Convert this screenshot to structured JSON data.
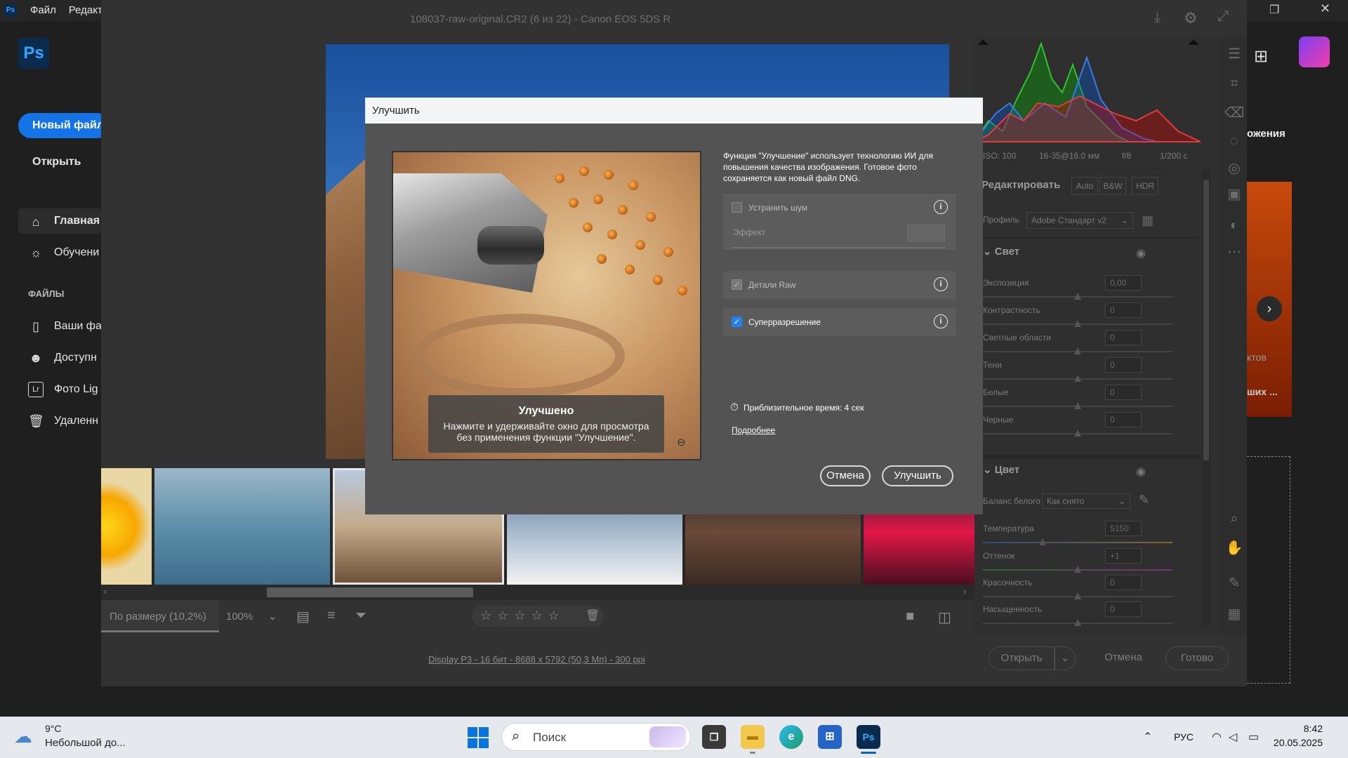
{
  "ps_home": {
    "menu": [
      "Файл",
      "Редакти"
    ],
    "logo": "Ps",
    "new_file_button": "Новый файл",
    "open_link": "Открыть",
    "nav": [
      {
        "icon": "home-icon",
        "label": "Главная"
      },
      {
        "icon": "lightbulb-icon",
        "label": "Обучени"
      }
    ],
    "files_heading": "ФАЙЛЫ",
    "files": [
      {
        "icon": "file-icon",
        "label": "Ваши фа"
      },
      {
        "icon": "people-icon",
        "label": "Доступн"
      },
      {
        "icon": "lightroom-icon",
        "label": "Фото Lig"
      },
      {
        "icon": "trash-icon",
        "label": "Удаленн"
      }
    ],
    "right_partial_1": "ожения",
    "right_partial_2": "ктов",
    "right_partial_3": "ших ..."
  },
  "acr": {
    "title": "108037-raw-original.CR2 (6 из 22)  -  Canon EOS 5DS R",
    "zoom_fit_label": "По размеру (10,2%)",
    "zoom_value": "100%",
    "status_link": "Display P3 - 16 бит - 8688 x 5792 (50,3 Мп) - 300 ppi",
    "exif": {
      "iso": "ISO: 100",
      "lens": "16-35@16.0 мм",
      "aperture": "f/8",
      "shutter": "1/200 с"
    },
    "edit_heading": "Редактировать",
    "edit_modes": [
      "Auto",
      "B&W",
      "HDR"
    ],
    "profile_label": "Профиль",
    "profile_value": "Adobe Стандарт v2",
    "light_section": "Свет",
    "light_sliders": [
      {
        "label": "Экспозиция",
        "value": "0,00"
      },
      {
        "label": "Контрастность",
        "value": "0"
      },
      {
        "label": "Светлые области",
        "value": "0"
      },
      {
        "label": "Тени",
        "value": "0"
      },
      {
        "label": "Белые",
        "value": "0"
      },
      {
        "label": "Черные",
        "value": "0"
      }
    ],
    "color_section": "Цвет",
    "wb_label": "Баланс белого",
    "wb_value": "Как снято",
    "color_sliders": [
      {
        "label": "Температура",
        "value": "5150"
      },
      {
        "label": "Оттенок",
        "value": "+1"
      },
      {
        "label": "Красочность",
        "value": "0"
      },
      {
        "label": "Насыщенность",
        "value": "0"
      }
    ],
    "open_button": "Открыть",
    "cancel_button": "Отмена",
    "done_button": "Готово"
  },
  "dialog": {
    "title": "Улучшить",
    "preview_title": "Улучшено",
    "preview_text": "Нажмите и удерживайте окно для просмотра без применения функции \"Улучшение\".",
    "description": "Функция \"Улучшение\" использует технологию ИИ для повышения качества изображения. Готовое фото сохраняется как новый файл DNG.",
    "denoise_label": "Устранить шум",
    "effect_label": "Эффект",
    "raw_details_label": "Детали Raw",
    "super_res_label": "Суперразрешение",
    "time_label": "Приблизительное время: 4 сек",
    "more_link": "Подробнее",
    "cancel_button": "Отмена",
    "enhance_button": "Улучшить"
  },
  "taskbar": {
    "weather_temp": "9°C",
    "weather_desc": "Небольшой до...",
    "search_placeholder": "Поиск",
    "language": "РУС",
    "time": "8:42",
    "date": "20.05.2025"
  }
}
